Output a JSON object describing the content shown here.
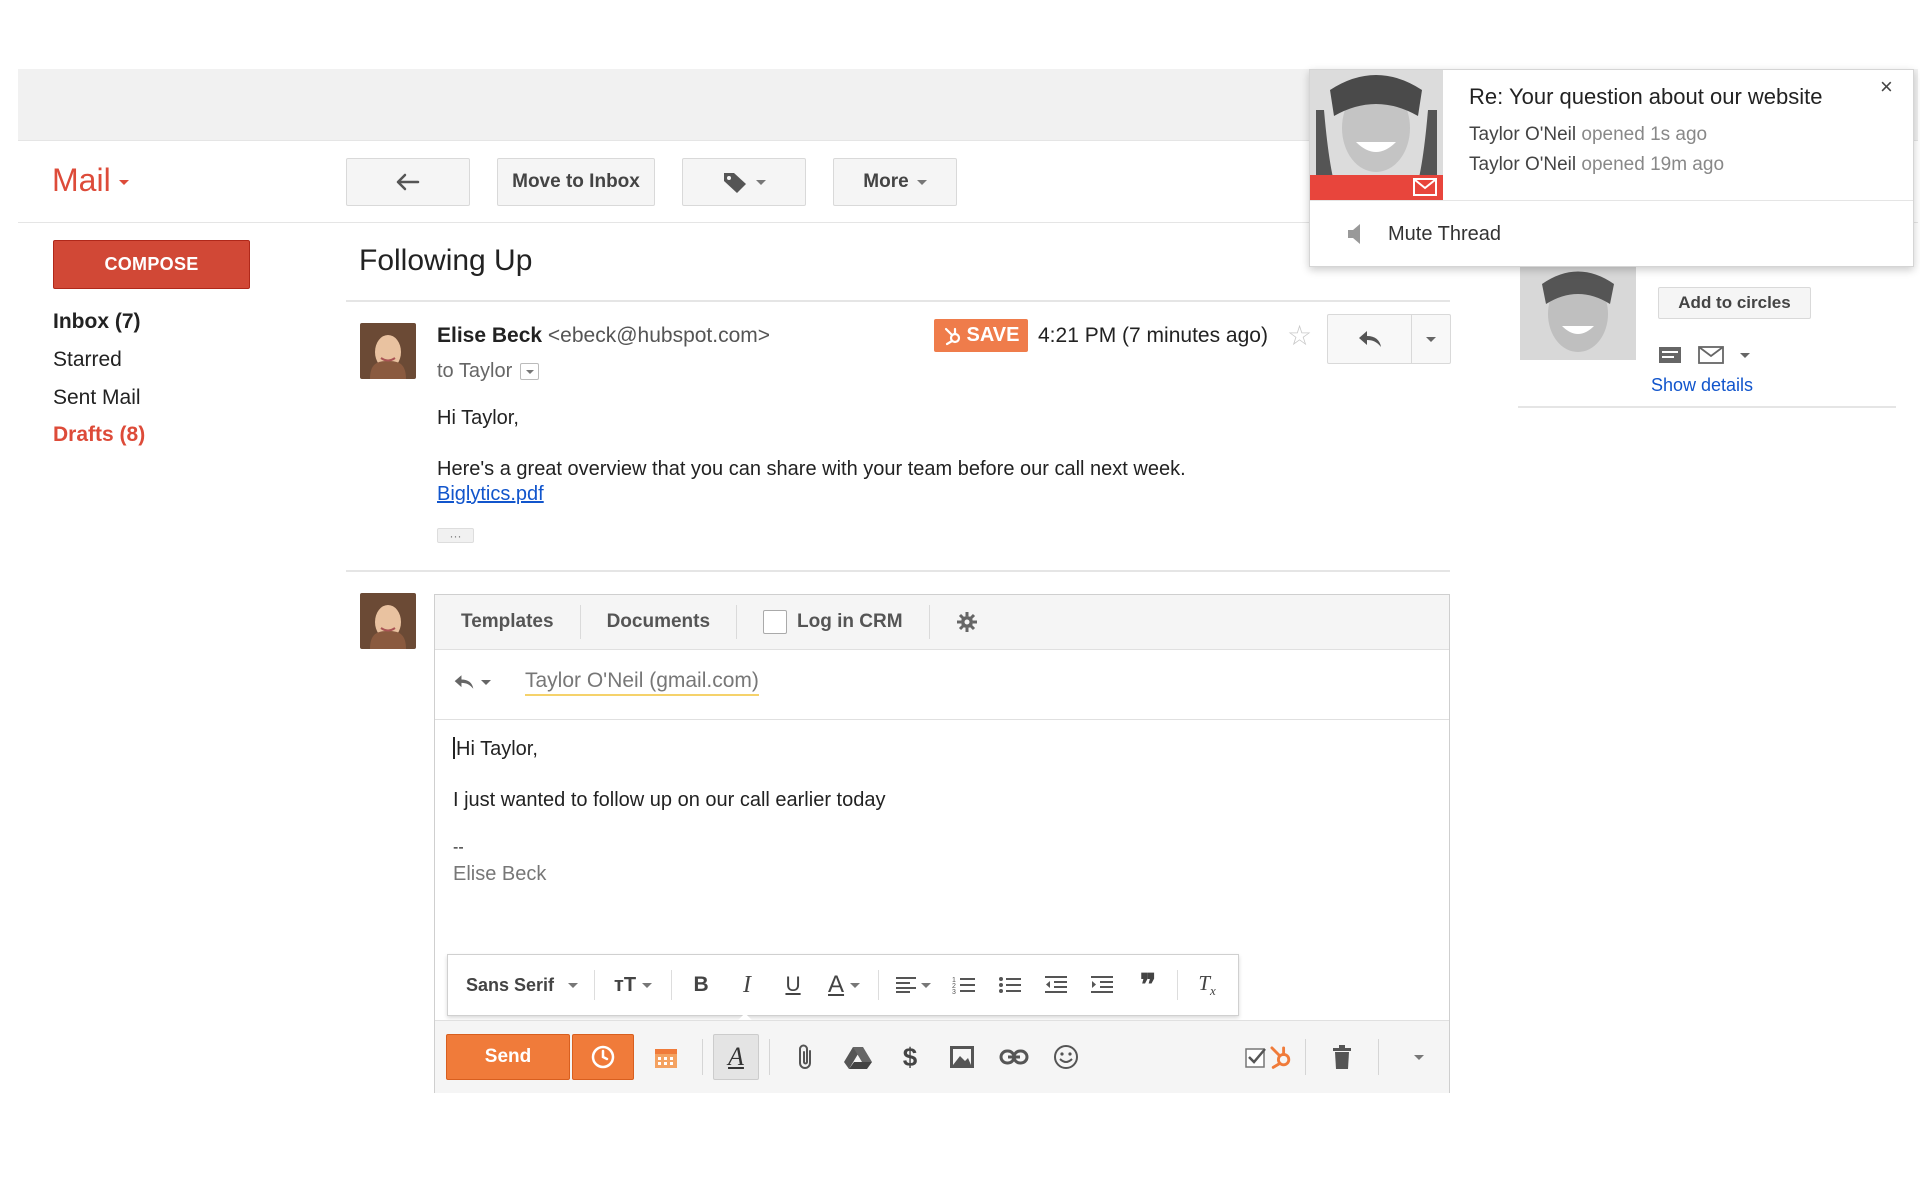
{
  "header": {
    "mail_label": "Mail",
    "toolbar": {
      "back_icon": "reply-arrow-icon",
      "move_to_inbox": "Move to Inbox",
      "labels_icon": "label-tag-icon",
      "more": "More"
    }
  },
  "sidebar": {
    "compose": "COMPOSE",
    "items": [
      {
        "label": "Inbox (7)",
        "style": "bold"
      },
      {
        "label": "Starred"
      },
      {
        "label": "Sent Mail"
      },
      {
        "label": "Drafts (8)",
        "style": "red-bold"
      }
    ]
  },
  "thread": {
    "subject": "Following Up",
    "message": {
      "sender_name": "Elise Beck",
      "sender_email": "<ebeck@hubspot.com>",
      "to": "to Taylor",
      "save_badge": "SAVE",
      "time": "4:21 PM (7 minutes ago)",
      "greeting": "Hi Taylor,",
      "body": "Here's a great overview that you can share with your team before our call next week.",
      "attachment_link": "Biglytics.pdf",
      "ellipsis": "···"
    }
  },
  "reply": {
    "hubspot_toolbar": {
      "templates": "Templates",
      "documents": "Documents",
      "log_in_crm": "Log in CRM",
      "log_in_crm_checked": false
    },
    "recipient": "Taylor O'Neil (gmail.com)",
    "draft": {
      "greeting": "Hi Taylor,",
      "line1": "I just wanted to follow up on our call earlier today",
      "sig_dashes": "--",
      "sig_name": "Elise Beck"
    },
    "format_bar": {
      "font": "Sans Serif"
    },
    "send": "Send"
  },
  "contact_card": {
    "add_to_circles": "Add to circles",
    "show_details": "Show details"
  },
  "notification": {
    "title": "Re: Your question about our website",
    "line1_name": "Taylor O'Neil",
    "line1_rest": "opened 1s ago",
    "line2_name": "Taylor O'Neil",
    "line2_rest": "opened 19m ago",
    "close": "×",
    "mute": "Mute Thread"
  },
  "colors": {
    "gmail_red": "#dd4b39",
    "compose_red": "#d14836",
    "hubspot_orange": "#f07b3a",
    "link_blue": "#1155cc"
  }
}
